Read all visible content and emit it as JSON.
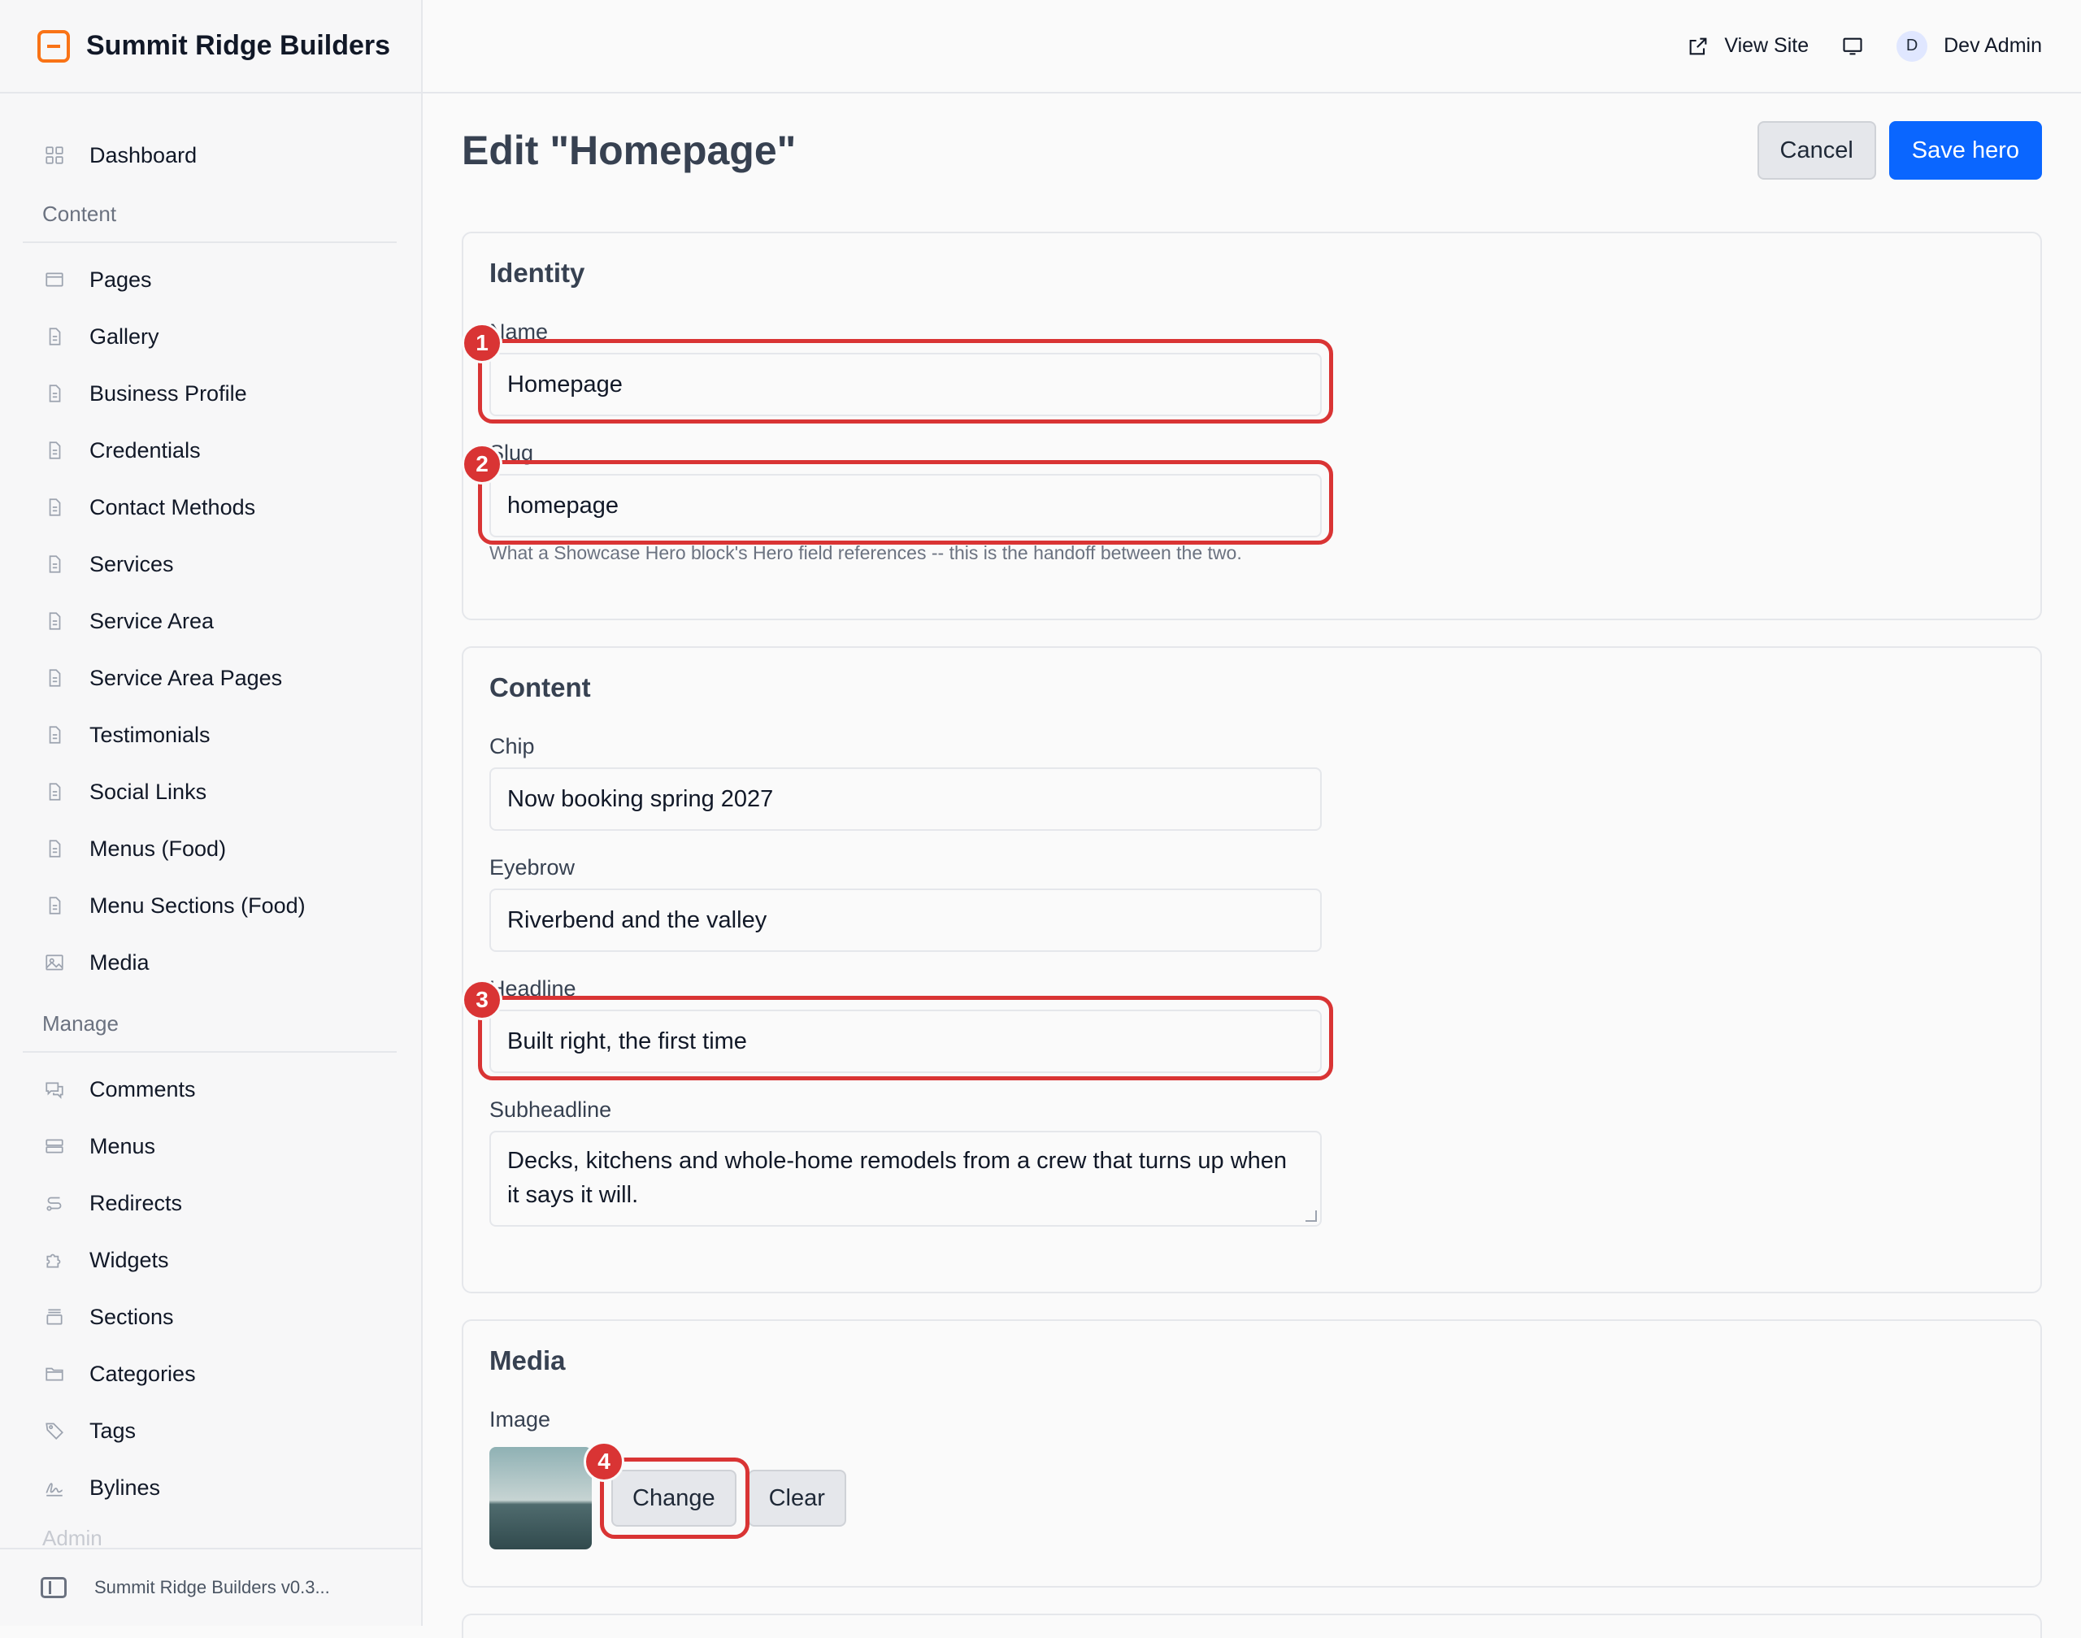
{
  "brand": {
    "name": "Summit Ridge Builders"
  },
  "topbar": {
    "view_site": "View Site",
    "user_initial": "D",
    "user_name": "Dev Admin"
  },
  "sidebar": {
    "dashboard": "Dashboard",
    "content_group": "Content",
    "content_items": [
      "Pages",
      "Gallery",
      "Business Profile",
      "Credentials",
      "Contact Methods",
      "Services",
      "Service Area",
      "Service Area Pages",
      "Testimonials",
      "Social Links",
      "Menus (Food)",
      "Menu Sections (Food)",
      "Media"
    ],
    "manage_group": "Manage",
    "manage_items": [
      "Comments",
      "Menus",
      "Redirects",
      "Widgets",
      "Sections",
      "Categories",
      "Tags",
      "Bylines"
    ],
    "admin_group": "Admin",
    "footer": "Summit Ridge Builders v0.3..."
  },
  "page": {
    "title": "Edit \"Homepage\"",
    "cancel": "Cancel",
    "save": "Save hero"
  },
  "identity": {
    "title": "Identity",
    "name_label": "Name",
    "name_value": "Homepage",
    "slug_label": "Slug",
    "slug_value": "homepage",
    "slug_help": "What a Showcase Hero block's Hero field references -- this is the handoff between the two."
  },
  "content": {
    "title": "Content",
    "chip_label": "Chip",
    "chip_value": "Now booking spring 2027",
    "eyebrow_label": "Eyebrow",
    "eyebrow_value": "Riverbend and the valley",
    "headline_label": "Headline",
    "headline_value": "Built right, the first time",
    "subheadline_label": "Subheadline",
    "subheadline_value": "Decks, kitchens and whole-home remodels from a crew that turns up when it says it will."
  },
  "media": {
    "title": "Media",
    "image_label": "Image",
    "change": "Change",
    "clear": "Clear"
  },
  "badges": [
    "1",
    "2",
    "3",
    "4"
  ],
  "colors": {
    "accent": "#0a66ff",
    "highlight": "#d93434",
    "brand": "#f97316"
  }
}
